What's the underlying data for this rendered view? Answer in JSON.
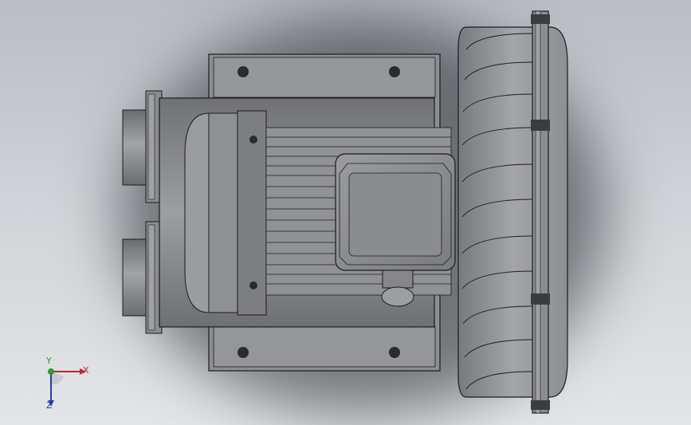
{
  "viewport": {
    "background_top": "#b9bdc4",
    "background_bottom": "#e3e5e7",
    "model_fill": "#8a8c8f",
    "model_dark": "#4d4f52",
    "model_light": "#a4a6a9",
    "edge_color": "#1b1b1b"
  },
  "triad": {
    "x_label": "X",
    "y_label": "Y",
    "z_label": "Z",
    "x_color": "#c0262a",
    "y_color": "#2e9a2e",
    "z_color": "#1f3fb0"
  }
}
